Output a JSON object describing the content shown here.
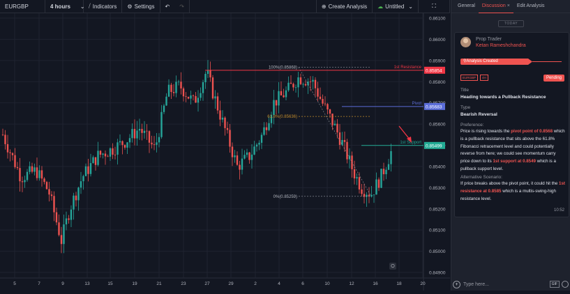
{
  "toolbar": {
    "symbol": "EURGBP",
    "interval": "4 hours",
    "indicators": "Indicators",
    "settings": "Settings",
    "create_analysis": "Create Analysis",
    "layout_name": "Untitled"
  },
  "chart": {
    "price_labels": [
      "0.86100",
      "0.86000",
      "0.85900",
      "0.85800",
      "0.85700",
      "0.85600",
      "0.85500",
      "0.85400",
      "0.85300",
      "0.85200",
      "0.85100",
      "0.85000",
      "0.84900"
    ],
    "date_labels": [
      "5",
      "7",
      "9",
      "13",
      "15",
      "19",
      "21",
      "23",
      "27",
      "29",
      "2",
      "4",
      "6",
      "10",
      "12",
      "16",
      "18",
      "20"
    ],
    "price_min": 0.849,
    "price_max": 0.861,
    "fib_100": "100%(0.85868)",
    "fib_618": "61.8%(0.85636)",
    "fib_0": "0%(0.85259)",
    "resistance_label": "1st Resistance",
    "resistance_price": "0.85854",
    "pivot_label": "Pivot",
    "pivot_price": "0.85683",
    "support_label": "1st Support",
    "support_price": "0.85499",
    "colors": {
      "up": "#26a69a",
      "down": "#ef5350",
      "resistance": "#f23645",
      "pivot": "#5b6dd9",
      "support": "#22ab94",
      "fib": "#c28b2b"
    }
  },
  "panel": {
    "tabs": [
      "General",
      "Discussion",
      "Edit Analysis"
    ],
    "tab_close": "×",
    "today": "TODAY",
    "role": "Prop Trader",
    "user": "Ketan Rameshchandra",
    "created": "Analysis Created",
    "tags": [
      "EURGBP",
      "4H"
    ],
    "status": "Pending",
    "title_label": "Title",
    "title": "Heading towards a Pullback Resistance",
    "type_label": "Type",
    "type": "Bearish Reversal",
    "preference_label": "Preference:",
    "pref_1": "Price is rising towards the ",
    "pref_hl1": "pivot point of 0.8568",
    "pref_2": " which is a pullback resistance that sits above the 61.8% Fibonacci retracement level and could potentially reverse from here; we could see momentum carry price down to its ",
    "pref_hl2": "1st support at 0.8549",
    "pref_3": " which is a pullback support level.",
    "alt_label": "Alternative Scenario:",
    "alt_1": "If price breaks above the pivot point, it could hit the ",
    "alt_hl": "1st resistance at 0.8585",
    "alt_2": " which is a multis-swing-high resistance level.",
    "time": "10:52",
    "input_placeholder": "Type here...",
    "gif": "GIF"
  }
}
